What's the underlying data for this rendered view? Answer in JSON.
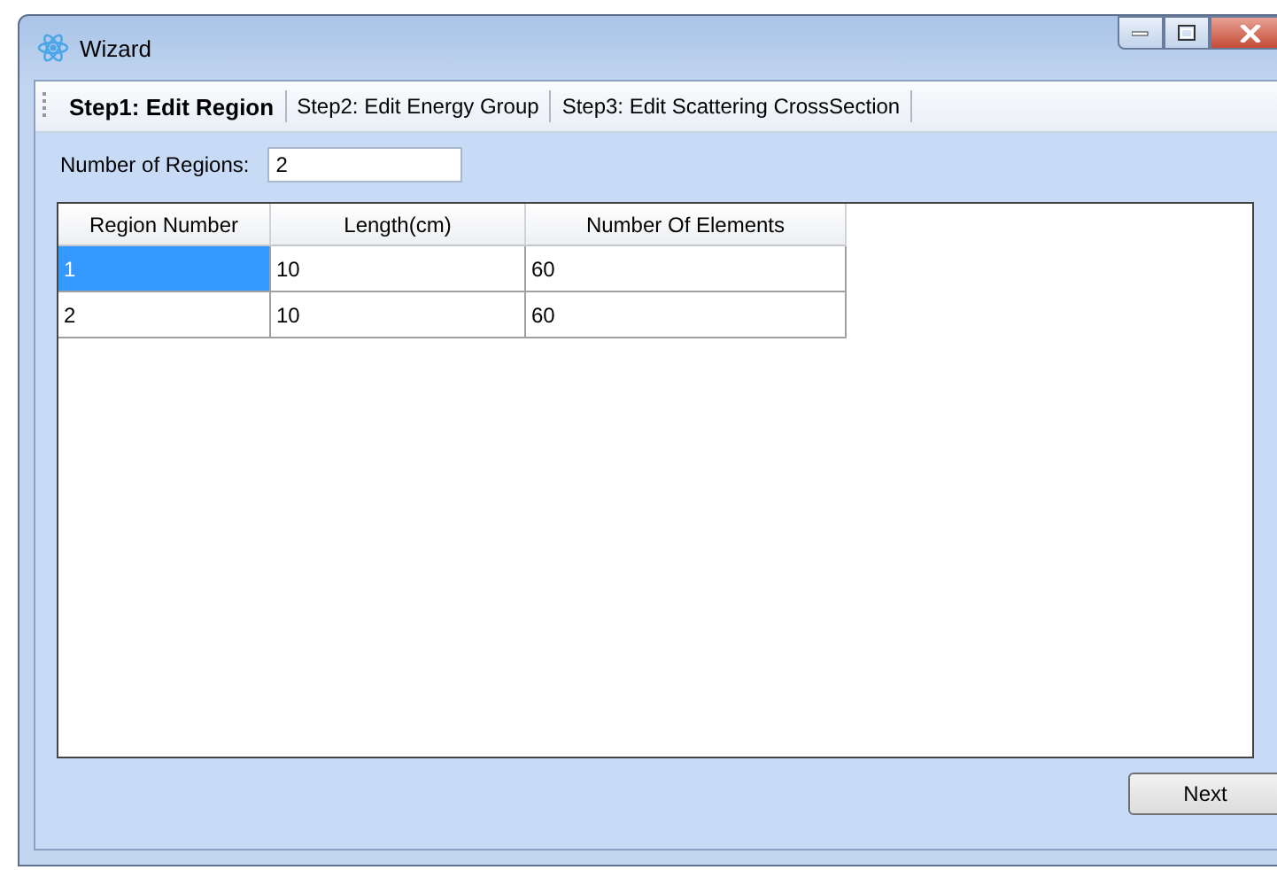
{
  "window": {
    "title": "Wizard"
  },
  "steps": [
    {
      "label": "Step1: Edit Region",
      "selected": true
    },
    {
      "label": "Step2: Edit Energy Group",
      "selected": false
    },
    {
      "label": "Step3: Edit Scattering CrossSection",
      "selected": false
    }
  ],
  "regions_field": {
    "label": "Number of Regions:",
    "value": "2"
  },
  "table": {
    "columns": [
      "Region Number",
      "Length(cm)",
      "Number Of Elements"
    ],
    "rows": [
      [
        {
          "text": "1",
          "selected": true
        },
        {
          "text": "10",
          "selected": false
        },
        {
          "text": "60",
          "selected": false
        }
      ],
      [
        {
          "text": "2",
          "selected": false
        },
        {
          "text": "10",
          "selected": false
        },
        {
          "text": "60",
          "selected": false
        }
      ]
    ]
  },
  "buttons": [
    "Next"
  ]
}
